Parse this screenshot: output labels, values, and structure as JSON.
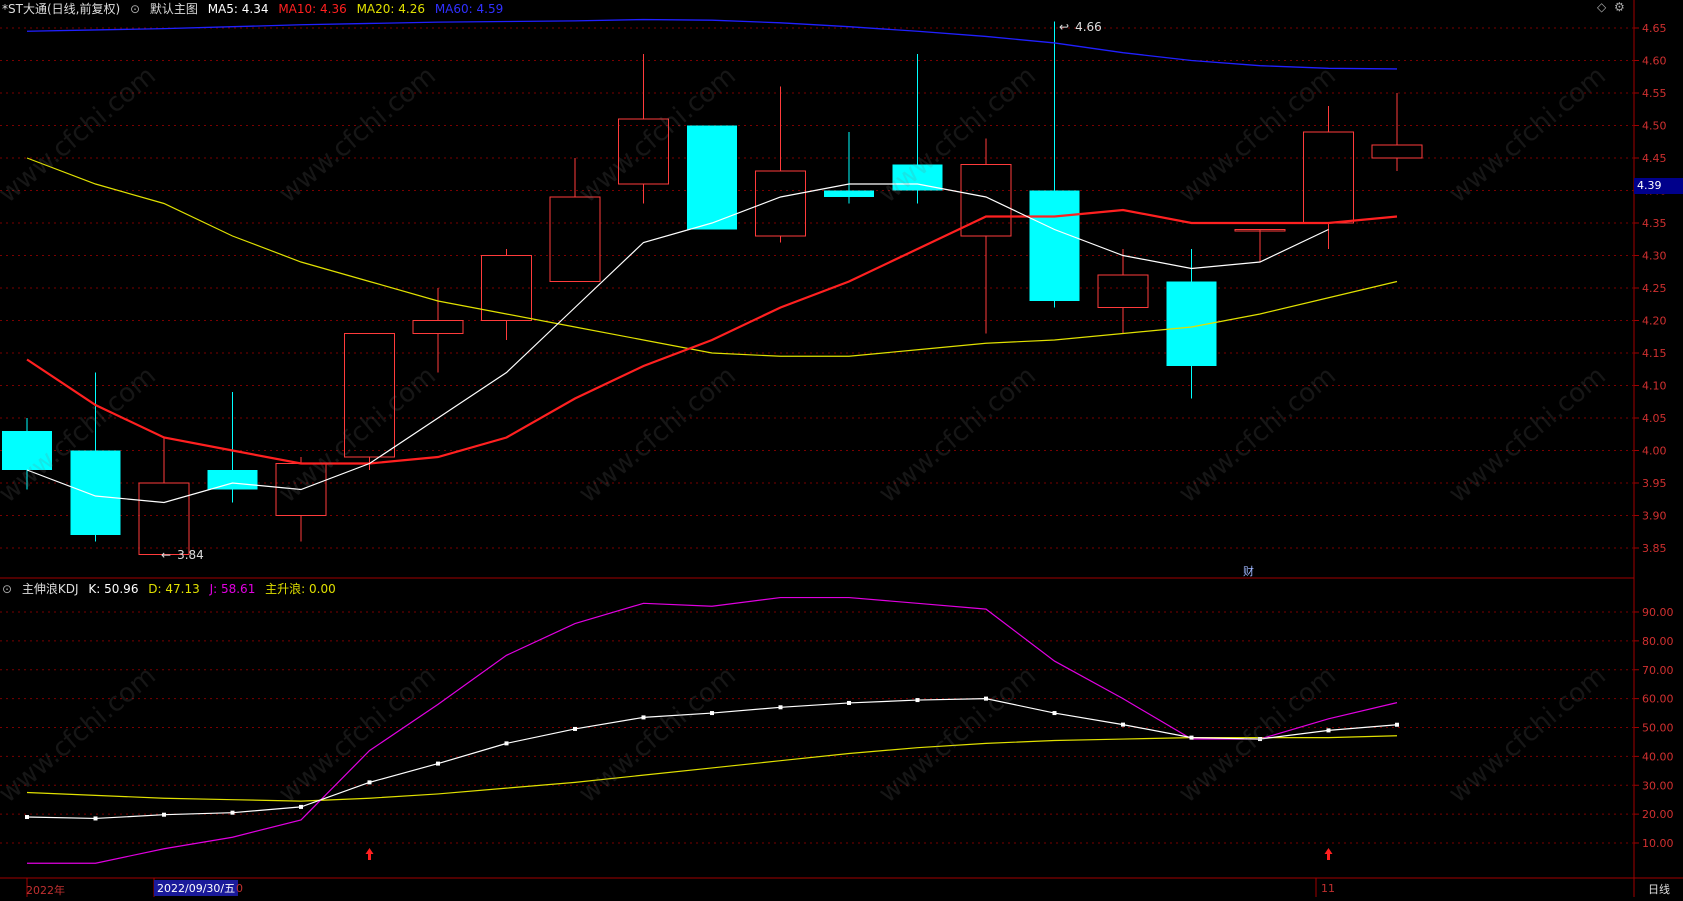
{
  "header": {
    "title": "*ST大通(日线,前复权)",
    "main_label": "默认主图",
    "ma5": "MA5: 4.34",
    "ma10": "MA10: 4.36",
    "ma20": "MA20: 4.26",
    "ma60": "MA60: 4.59"
  },
  "kdj_header": {
    "title": "主伸浪KDJ",
    "k": "K: 50.96",
    "d": "D: 47.13",
    "j": "J: 58.61",
    "main": "主升浪: 0.00"
  },
  "colors": {
    "up": "#ff3b3b",
    "down": "#00ffff",
    "ma5": "#ffffff",
    "ma10": "#ff2020",
    "ma20": "#e0e000",
    "ma60": "#2020ff",
    "kdj_j": "#e000e0",
    "kdj_d": "#e0e000",
    "kdj_k": "#ffffff",
    "grid": "#7a0000"
  },
  "annotations": {
    "high": "4.66",
    "low": "3.84",
    "fin_mark": "财",
    "current_price": "4.39"
  },
  "bottom_axis": {
    "year": "2022年",
    "date_box": "2022/09/30/五",
    "date_suffix": "0",
    "month_mark": "11",
    "period": "日线"
  },
  "watermark": "www.cfchi.com",
  "chart_data": [
    {
      "type": "candlestick",
      "ylim": [
        3.8,
        4.67
      ],
      "yticks": [
        "4.65",
        "4.60",
        "4.55",
        "4.50",
        "4.45",
        "4.40",
        "4.35",
        "4.30",
        "4.25",
        "4.20",
        "4.15",
        "4.10",
        "4.05",
        "4.00",
        "3.95",
        "3.90",
        "3.85"
      ],
      "candles": [
        {
          "o": 4.03,
          "h": 4.05,
          "l": 3.94,
          "c": 3.97
        },
        {
          "o": 4.0,
          "h": 4.12,
          "l": 3.86,
          "c": 3.87
        },
        {
          "o": 3.84,
          "h": 4.02,
          "l": 3.84,
          "c": 3.95
        },
        {
          "o": 3.97,
          "h": 4.09,
          "l": 3.92,
          "c": 3.94
        },
        {
          "o": 3.9,
          "h": 3.99,
          "l": 3.86,
          "c": 3.98
        },
        {
          "o": 3.99,
          "h": 4.18,
          "l": 3.97,
          "c": 4.18
        },
        {
          "o": 4.18,
          "h": 4.25,
          "l": 4.12,
          "c": 4.2
        },
        {
          "o": 4.2,
          "h": 4.31,
          "l": 4.17,
          "c": 4.3
        },
        {
          "o": 4.26,
          "h": 4.45,
          "l": 4.26,
          "c": 4.39
        },
        {
          "o": 4.41,
          "h": 4.61,
          "l": 4.38,
          "c": 4.51
        },
        {
          "o": 4.5,
          "h": 4.5,
          "l": 4.34,
          "c": 4.34
        },
        {
          "o": 4.33,
          "h": 4.56,
          "l": 4.32,
          "c": 4.43
        },
        {
          "o": 4.4,
          "h": 4.49,
          "l": 4.38,
          "c": 4.39
        },
        {
          "o": 4.44,
          "h": 4.61,
          "l": 4.38,
          "c": 4.4
        },
        {
          "o": 4.33,
          "h": 4.48,
          "l": 4.18,
          "c": 4.44
        },
        {
          "o": 4.4,
          "h": 4.66,
          "l": 4.22,
          "c": 4.23
        },
        {
          "o": 4.22,
          "h": 4.31,
          "l": 4.18,
          "c": 4.27
        },
        {
          "o": 4.26,
          "h": 4.31,
          "l": 4.08,
          "c": 4.13
        },
        {
          "o": 4.34,
          "h": 4.34,
          "l": 4.29,
          "c": 4.34
        },
        {
          "o": 4.35,
          "h": 4.53,
          "l": 4.31,
          "c": 4.49
        },
        {
          "o": 4.45,
          "h": 4.55,
          "l": 4.43,
          "c": 4.47
        }
      ],
      "ma5": [
        3.97,
        3.93,
        3.92,
        3.95,
        3.94,
        3.98,
        4.05,
        4.12,
        4.22,
        4.32,
        4.35,
        4.39,
        4.41,
        4.41,
        4.39,
        4.34,
        4.3,
        4.28,
        4.29,
        4.34
      ],
      "ma10": [
        4.14,
        4.07,
        4.02,
        4.0,
        3.98,
        3.98,
        3.99,
        4.02,
        4.08,
        4.13,
        4.17,
        4.22,
        4.26,
        4.31,
        4.36,
        4.36,
        4.37,
        4.35,
        4.35,
        4.35,
        4.36
      ],
      "ma20": [
        4.45,
        4.41,
        4.38,
        4.33,
        4.29,
        4.26,
        4.23,
        4.21,
        4.19,
        4.17,
        4.15,
        4.145,
        4.145,
        4.155,
        4.165,
        4.17,
        4.18,
        4.19,
        4.21,
        4.235,
        4.26
      ],
      "ma60": [
        4.645,
        4.647,
        4.649,
        4.652,
        4.655,
        4.657,
        4.659,
        4.66,
        4.661,
        4.663,
        4.662,
        4.658,
        4.652,
        4.645,
        4.637,
        4.627,
        4.612,
        4.6,
        4.592,
        4.588,
        4.587
      ]
    },
    {
      "type": "line",
      "ylim": [
        0,
        100
      ],
      "yticks": [
        "90.00",
        "80.00",
        "70.00",
        "60.00",
        "50.00",
        "40.00",
        "30.00",
        "20.00",
        "10.00"
      ],
      "series": [
        {
          "name": "K",
          "values": [
            19,
            18.5,
            19.8,
            20.5,
            22.5,
            31,
            37.5,
            44.5,
            49.5,
            53.5,
            55,
            57,
            58.5,
            59.5,
            60,
            55,
            51,
            46.5,
            46,
            49,
            50.96
          ]
        },
        {
          "name": "D",
          "values": [
            27.5,
            26.5,
            25.5,
            25,
            24.5,
            25.5,
            27,
            29,
            31,
            33.5,
            36,
            38.5,
            41,
            43,
            44.5,
            45.5,
            46,
            46.5,
            46.5,
            46.5,
            47.13
          ]
        },
        {
          "name": "J",
          "values": [
            3,
            3,
            8,
            12,
            18,
            42,
            58,
            75,
            86,
            93,
            92,
            95,
            95,
            93,
            91,
            73,
            60,
            46,
            46,
            53,
            58.61
          ]
        }
      ],
      "markers": [
        5,
        19
      ]
    }
  ]
}
